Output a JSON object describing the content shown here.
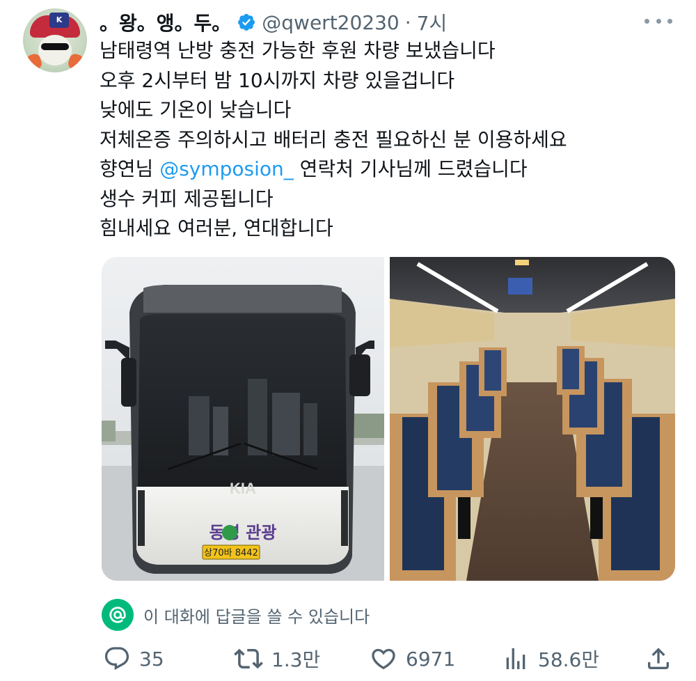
{
  "user": {
    "display_name": "。왕。앵。두。",
    "handle": "@qwert20230",
    "separator": "·",
    "time": "7시",
    "avatar_badge": "K"
  },
  "tweet": {
    "lines": [
      "남태령역 난방 충전 가능한 후원 차량 보냈습니다",
      "오후 2시부터 밤 10시까지 차량 있을겁니다",
      "낮에도 기온이 낮습니다",
      "저체온증 주의하시고 배터리 충전 필요하신 분 이용하세요",
      "생수 커피 제공됩니다",
      "힘내세요 여러분, 연대합니다"
    ],
    "mention_line": {
      "before": "향연님 ",
      "mention": "@symposion_",
      "after": " 연락처 기사님께 드렸습니다"
    }
  },
  "media": {
    "bus": {
      "logo": "KIA",
      "company": "동영 관광",
      "plate": "상70바 8442"
    }
  },
  "reply_restriction": {
    "text": "이 대화에 답글을 쓸 수 있습니다"
  },
  "actions": {
    "replies": "35",
    "retweets": "1.3만",
    "likes": "6971",
    "views": "58.6만"
  },
  "colors": {
    "accent": "#1d9bf0",
    "verified": "#1d9bf0",
    "reply_icon_bg": "#00ba7c",
    "muted": "#536471"
  },
  "icons": [
    "verified-icon",
    "more-icon",
    "at-icon",
    "reply-icon",
    "retweet-icon",
    "like-icon",
    "views-icon",
    "share-icon"
  ]
}
